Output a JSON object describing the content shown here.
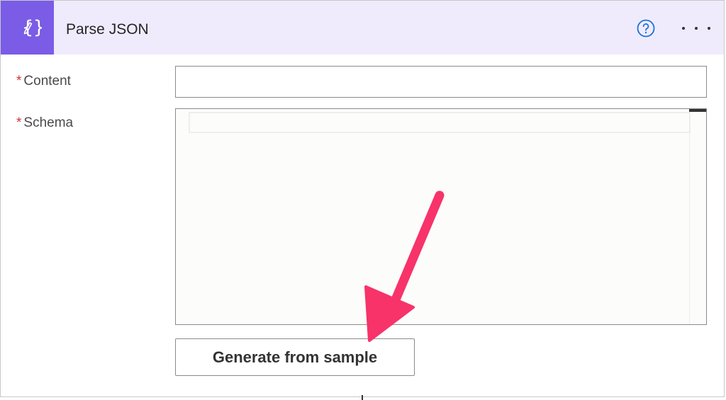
{
  "action": {
    "title": "Parse JSON",
    "icon": "json-edit-icon",
    "help_icon": "help-circle-icon",
    "more_icon": "more-horizontal-icon"
  },
  "fields": {
    "required_marker": "*",
    "content": {
      "label": "Content",
      "value": ""
    },
    "schema": {
      "label": "Schema",
      "value": ""
    }
  },
  "buttons": {
    "generate": "Generate from sample"
  },
  "annotation": {
    "arrow_color": "#f7336a"
  },
  "colors": {
    "header_bg": "#efebfd",
    "icon_bg": "#7a5ce6",
    "help_icon": "#1a73d6",
    "required": "#d13438"
  }
}
